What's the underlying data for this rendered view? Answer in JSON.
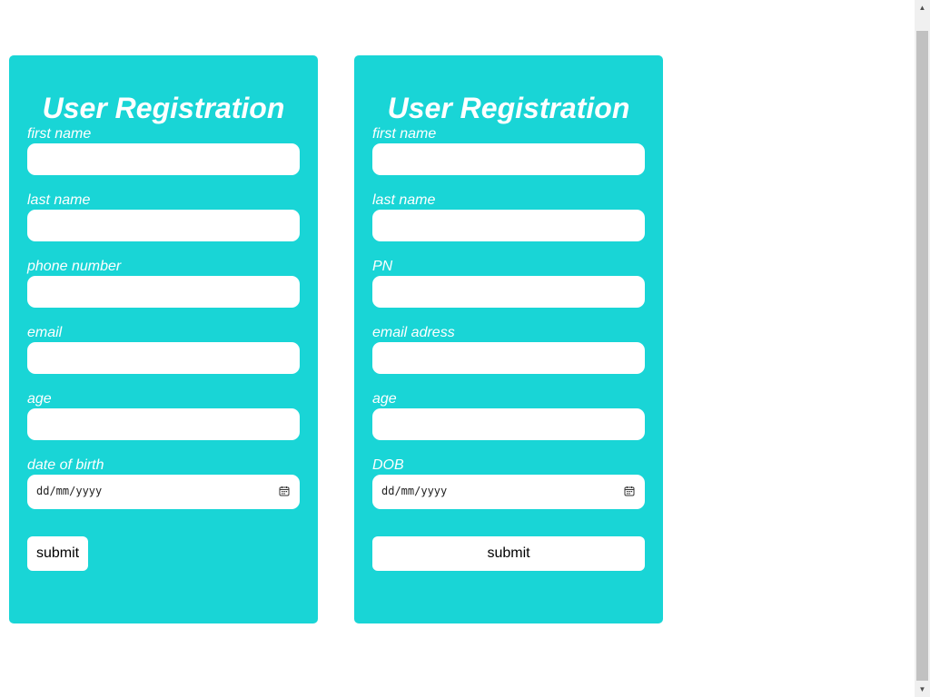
{
  "forms": [
    {
      "title": "User Registration",
      "fields": [
        {
          "label": "first name",
          "value": ""
        },
        {
          "label": "last name",
          "value": ""
        },
        {
          "label": "phone number",
          "value": ""
        },
        {
          "label": "email",
          "value": ""
        },
        {
          "label": "age",
          "value": ""
        }
      ],
      "date_label": "date of birth",
      "date_placeholder": "dd/mm/yyyy",
      "submit_label": "submit"
    },
    {
      "title": "User Registration",
      "fields": [
        {
          "label": "first name",
          "value": ""
        },
        {
          "label": "last name",
          "value": ""
        },
        {
          "label": "PN",
          "value": ""
        },
        {
          "label": "email adress",
          "value": ""
        },
        {
          "label": "age",
          "value": ""
        }
      ],
      "date_label": "DOB",
      "date_placeholder": "dd/mm/yyyy",
      "submit_label": "submit"
    }
  ],
  "colors": {
    "card_background": "#19d5d6",
    "page_background": "#ffffff",
    "text_on_card": "#ffffff"
  },
  "icons": {
    "date_picker": "calendar-icon",
    "scroll_up": "scroll-up-arrow-icon",
    "scroll_down": "scroll-down-arrow-icon"
  }
}
